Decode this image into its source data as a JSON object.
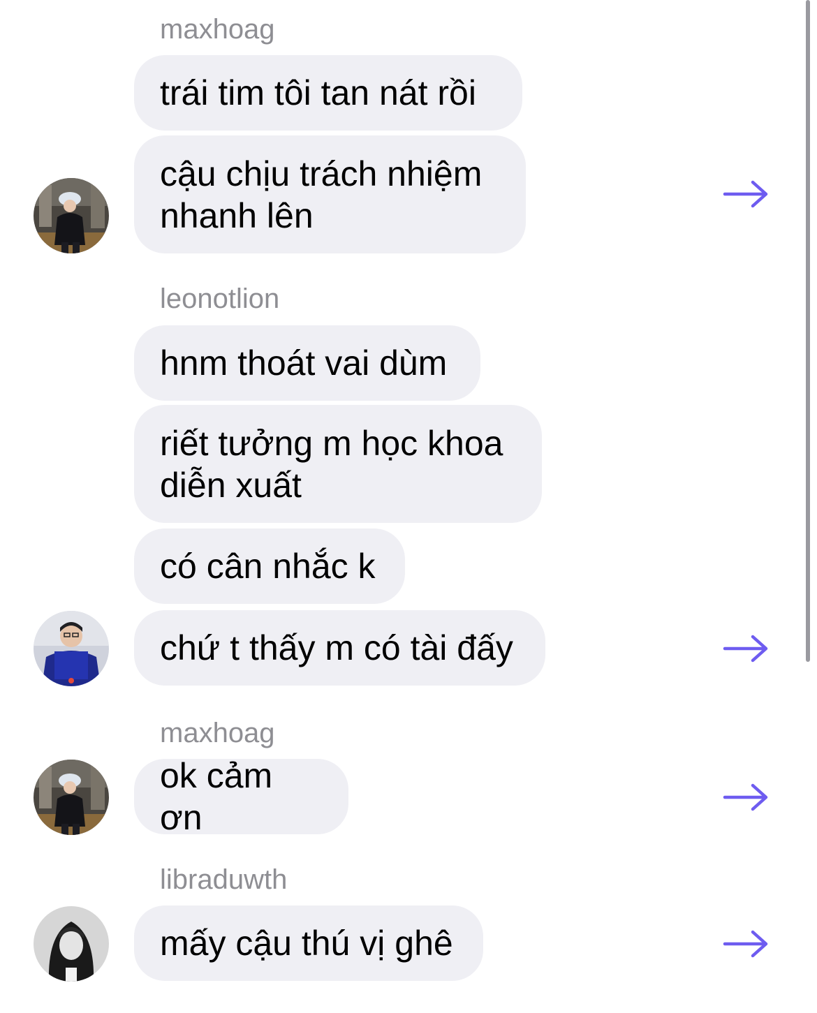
{
  "groups": [
    {
      "sender": "maxhoag",
      "messages": [
        "trái tim tôi tan nát rồi",
        "cậu chịu trách nhiệm nhanh lên"
      ],
      "avatar_icon": "person-photo-icon"
    },
    {
      "sender": "leonotlion",
      "messages": [
        "hnm thoát vai dùm",
        "riết tưởng m học khoa diễn xuất",
        "có cân nhắc k",
        "chứ t thấy m có tài đấy"
      ],
      "avatar_icon": "person-photo-icon"
    },
    {
      "sender": "maxhoag",
      "messages": [
        "ok cảm ơn"
      ],
      "avatar_icon": "person-photo-icon"
    },
    {
      "sender": "libraduwth",
      "messages": [
        "mấy cậu thú vị ghê"
      ],
      "avatar_icon": "person-photo-icon"
    }
  ],
  "share_icon": "arrow-right-icon",
  "colors": {
    "bubble": "#efeff4",
    "sender": "#8e8e93",
    "accent": "#6e5cf0"
  }
}
